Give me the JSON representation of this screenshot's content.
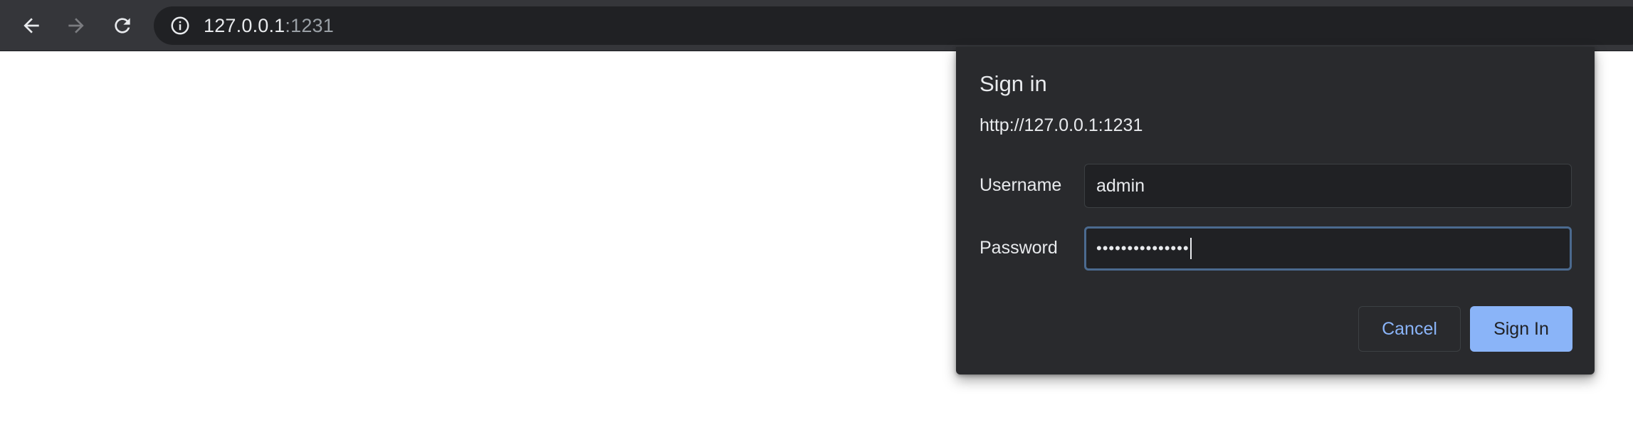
{
  "browser": {
    "nav": {
      "back_icon": "arrow-left-icon",
      "forward_icon": "arrow-right-icon",
      "reload_icon": "reload-icon"
    },
    "omnibox": {
      "info_icon": "info-icon",
      "url_host": "127.0.0.1",
      "url_port": ":1231"
    }
  },
  "auth_dialog": {
    "title": "Sign in",
    "origin": "http://127.0.0.1:1231",
    "username_label": "Username",
    "username_value": "admin",
    "password_label": "Password",
    "password_masked": "•••••••••••••••",
    "cancel_label": "Cancel",
    "signin_label": "Sign In"
  },
  "colors": {
    "toolbar_bg": "#35363a",
    "omnibox_bg": "#202124",
    "dialog_bg": "#292a2d",
    "accent": "#8ab4f8",
    "focus_border": "#4b6a8f"
  }
}
